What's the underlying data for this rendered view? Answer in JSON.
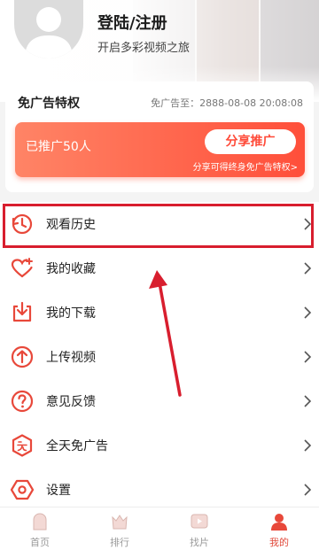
{
  "header": {
    "login_title": "登陆/注册",
    "login_subtitle": "开启多彩视频之旅"
  },
  "ad_card": {
    "title": "免广告特权",
    "expire_text": "免广告至：2888-08-08 20:08:08",
    "promoted_count": "已推广50人",
    "share_button": "分享推广",
    "share_note": "分享可得终身免广告特权>"
  },
  "menu": {
    "items": [
      {
        "label": "观看历史",
        "icon": "history-icon",
        "highlighted": true
      },
      {
        "label": "我的收藏",
        "icon": "favorite-heart-icon"
      },
      {
        "label": "我的下载",
        "icon": "download-icon"
      },
      {
        "label": "上传视频",
        "icon": "upload-icon"
      },
      {
        "label": "意见反馈",
        "icon": "feedback-icon"
      },
      {
        "label": "全天免广告",
        "icon": "ad-free-icon"
      },
      {
        "label": "设置",
        "icon": "settings-icon"
      }
    ]
  },
  "tabbar": {
    "tabs": [
      {
        "label": "首页",
        "icon": "home-icon",
        "active": false
      },
      {
        "label": "排行",
        "icon": "ranking-icon",
        "active": false
      },
      {
        "label": "找片",
        "icon": "find-video-icon",
        "active": false
      },
      {
        "label": "我的",
        "icon": "profile-icon",
        "active": true
      }
    ]
  },
  "colors": {
    "accent": "#ff4f3a",
    "icon_red": "#e8483a",
    "highlight_box": "#d81e2e"
  }
}
